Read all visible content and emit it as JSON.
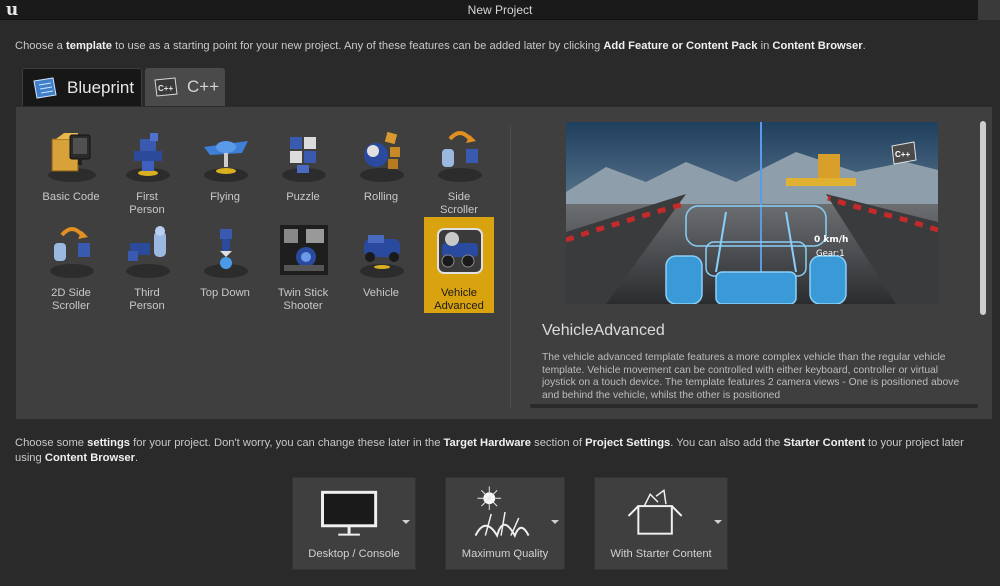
{
  "window": {
    "title": "New Project"
  },
  "intro": {
    "p1": "Choose a ",
    "b1": "template",
    "p2": " to use as a starting point for your new project.  Any of these features can be added later by clicking ",
    "b2": "Add Feature or Content Pack",
    "p3": " in ",
    "b3": "Content Browser",
    "p4": "."
  },
  "tabs": [
    {
      "label": "Blueprint",
      "active": true,
      "icon": "blueprint-icon"
    },
    {
      "label": "C++",
      "active": false,
      "icon": "cpp-icon"
    }
  ],
  "templates": [
    {
      "label": "Basic Code",
      "icon": "basic-code-icon"
    },
    {
      "label": "First\nPerson",
      "icon": "first-person-icon"
    },
    {
      "label": "Flying",
      "icon": "flying-icon"
    },
    {
      "label": "Puzzle",
      "icon": "puzzle-icon"
    },
    {
      "label": "Rolling",
      "icon": "rolling-icon"
    },
    {
      "label": "Side\nScroller",
      "icon": "side-scroller-icon"
    },
    {
      "label": "2D Side\nScroller",
      "icon": "2d-side-scroller-icon"
    },
    {
      "label": "Third\nPerson",
      "icon": "third-person-icon"
    },
    {
      "label": "Top Down",
      "icon": "top-down-icon"
    },
    {
      "label": "Twin Stick\nShooter",
      "icon": "twin-stick-shooter-icon"
    },
    {
      "label": "Vehicle",
      "icon": "vehicle-icon"
    },
    {
      "label": "Vehicle\nAdvanced",
      "icon": "vehicle-advanced-icon",
      "selected": true
    }
  ],
  "preview": {
    "speed": "0 km/h",
    "gear": "Gear:1",
    "badge": "C++"
  },
  "detail": {
    "title": "VehicleAdvanced",
    "description": "The vehicle advanced template features a more complex vehicle than the regular vehicle template. Vehicle movement can be controlled with either keyboard, controller or virtual joystick on a touch device. The template features 2 camera views - One is positioned above and behind the vehicle, whilst the other is positioned"
  },
  "settings_text": {
    "p1": "Choose some ",
    "b1": "settings",
    "p2": " for your project.  Don't worry, you can change these later in the ",
    "b2": "Target Hardware",
    "p3": " section of ",
    "b3": "Project Settings",
    "p4": ".  You can also add the ",
    "b4": "Starter Content",
    "p5": " to your project later using ",
    "b5": "Content Browser",
    "p6": "."
  },
  "settings": [
    {
      "label": "Desktop / Console",
      "icon": "monitor-icon"
    },
    {
      "label": "Maximum Quality",
      "icon": "quality-icon"
    },
    {
      "label": "With Starter Content",
      "icon": "starter-content-icon"
    }
  ],
  "colors": {
    "selected": "#d9a310",
    "background": "#2a2a2a",
    "panel": "#3f3f3f"
  }
}
